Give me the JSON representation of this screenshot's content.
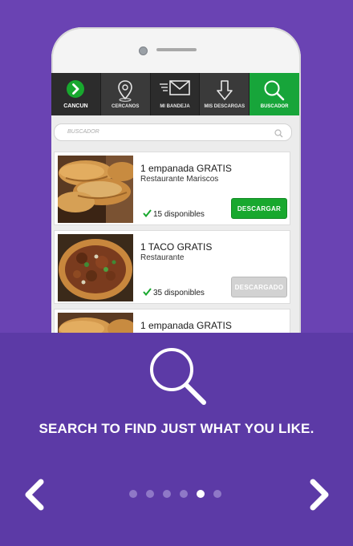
{
  "nav": {
    "items": [
      {
        "label": "CANCUN",
        "icon": "chevron-right-icon"
      },
      {
        "label": "CERCANOS",
        "icon": "location-pin-icon"
      },
      {
        "label": "MI BANDEJA",
        "icon": "inbox-envelope-icon"
      },
      {
        "label": "MIS DESCARGAS",
        "icon": "download-arrow-icon"
      },
      {
        "label": "BUSCADOR",
        "icon": "search-icon"
      }
    ],
    "active_index": 4
  },
  "search": {
    "placeholder": "BUSCADOR"
  },
  "cards": [
    {
      "title": "1 empanada GRATIS",
      "subtitle": "Restaurante Mariscos",
      "availability": "15 disponibles",
      "button": "DESCARGAR",
      "button_state": "enabled"
    },
    {
      "title": "1 TACO GRATIS",
      "subtitle": "Restaurante",
      "availability": "35 disponibles",
      "button": "DESCARGADO",
      "button_state": "disabled"
    },
    {
      "title": "1 empanada GRATIS"
    }
  ],
  "tagline": "SEARCH TO FIND JUST WHAT YOU LIKE.",
  "pagination": {
    "total": 6,
    "current": 5
  },
  "colors": {
    "background": "#6a43b3",
    "panel": "#5c3aa6",
    "accent_green": "#18a82e",
    "nav_dark": "#2c2c2c"
  }
}
